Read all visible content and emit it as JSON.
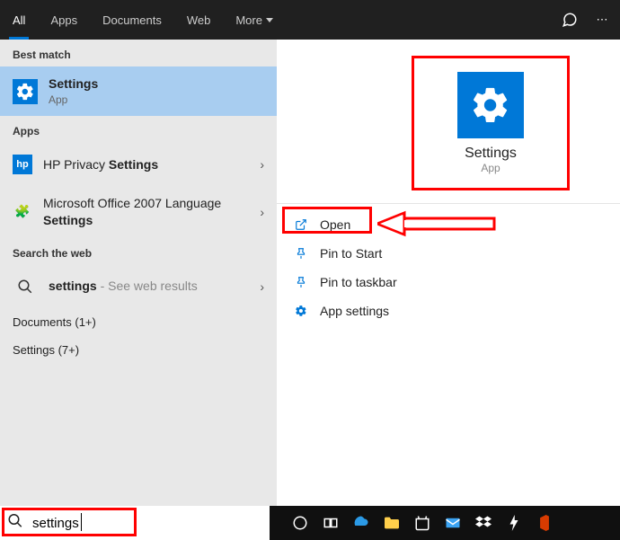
{
  "tabs": {
    "all": "All",
    "apps": "Apps",
    "documents": "Documents",
    "web": "Web",
    "more": "More"
  },
  "sections": {
    "best": "Best match",
    "apps": "Apps",
    "web": "Search the web"
  },
  "best_match": {
    "title": "Settings",
    "sub": "App"
  },
  "apps_list": {
    "hp": {
      "prefix": "HP Privacy ",
      "bold": "Settings"
    },
    "office": {
      "prefix": "Microsoft Office 2007 Language ",
      "bold": "Settings"
    }
  },
  "web_row": {
    "bold": "settings",
    "suffix": " - See web results"
  },
  "collapse": {
    "docs": "Documents (1+)",
    "settings": "Settings (7+)"
  },
  "right_tile": {
    "title": "Settings",
    "sub": "App"
  },
  "actions": {
    "open": "Open",
    "pin_start": "Pin to Start",
    "pin_taskbar": "Pin to taskbar",
    "app_settings": "App settings"
  },
  "search": {
    "value": "settings"
  }
}
